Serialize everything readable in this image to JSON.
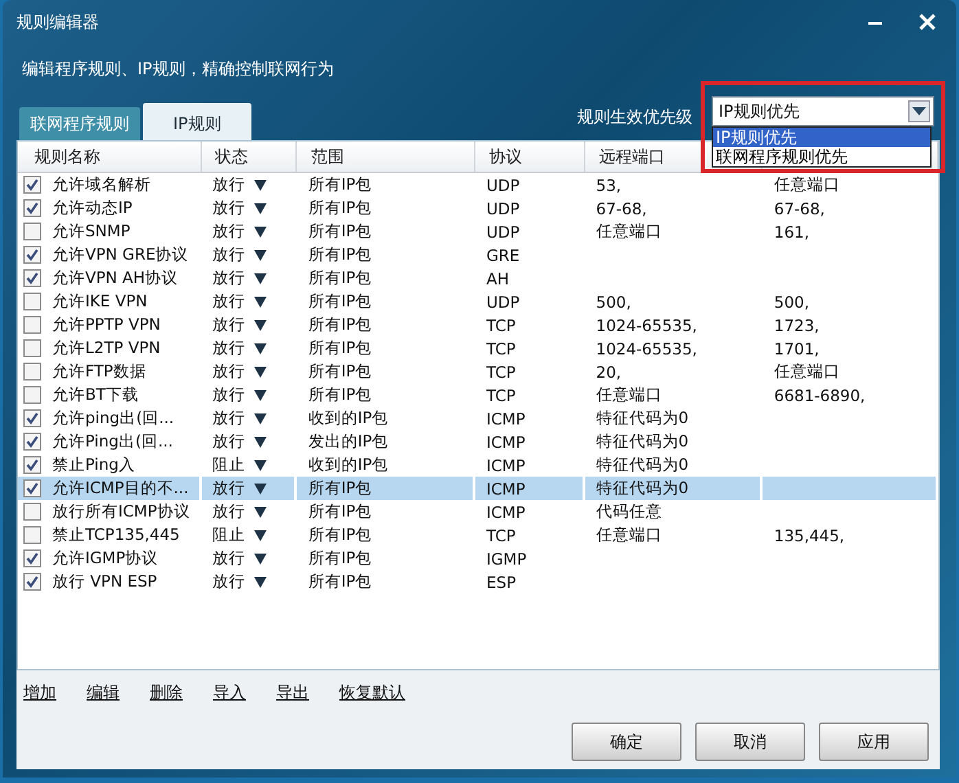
{
  "window": {
    "title": "规则编辑器",
    "description": "编辑程序规则、IP规则，精确控制联网行为"
  },
  "tabs": [
    {
      "label": "联网程序规则",
      "selected": false
    },
    {
      "label": "IP规则",
      "selected": true
    }
  ],
  "priority": {
    "label": "规则生效优先级",
    "value": "IP规则优先",
    "expanded": true,
    "options": [
      {
        "label": "IP规则优先",
        "selected": true
      },
      {
        "label": "联网程序规则优先",
        "selected": false
      }
    ]
  },
  "table": {
    "columns": [
      "规则名称",
      "状态",
      "范围",
      "协议",
      "远程端口"
    ],
    "rows": [
      {
        "checked": true,
        "selected": false,
        "name": "允许域名解析",
        "status": "放行",
        "scope": "所有IP包",
        "protocol": "UDP",
        "remote_port": "53,",
        "column_6": "任意端口"
      },
      {
        "checked": true,
        "selected": false,
        "name": "允许动态IP",
        "status": "放行",
        "scope": "所有IP包",
        "protocol": "UDP",
        "remote_port": "67-68,",
        "column_6": "67-68,"
      },
      {
        "checked": false,
        "selected": false,
        "name": "允许SNMP",
        "status": "放行",
        "scope": "所有IP包",
        "protocol": "UDP",
        "remote_port": "任意端口",
        "column_6": "161,"
      },
      {
        "checked": true,
        "selected": false,
        "name": "允许VPN GRE协议",
        "status": "放行",
        "scope": "所有IP包",
        "protocol": "GRE",
        "remote_port": "",
        "column_6": ""
      },
      {
        "checked": true,
        "selected": false,
        "name": "允许VPN AH协议",
        "status": "放行",
        "scope": "所有IP包",
        "protocol": "AH",
        "remote_port": "",
        "column_6": ""
      },
      {
        "checked": false,
        "selected": false,
        "name": "允许IKE VPN",
        "status": "放行",
        "scope": "所有IP包",
        "protocol": "UDP",
        "remote_port": "500,",
        "column_6": "500,"
      },
      {
        "checked": false,
        "selected": false,
        "name": "允许PPTP VPN",
        "status": "放行",
        "scope": "所有IP包",
        "protocol": "TCP",
        "remote_port": "1024-65535,",
        "column_6": "1723,"
      },
      {
        "checked": false,
        "selected": false,
        "name": "允许L2TP VPN",
        "status": "放行",
        "scope": "所有IP包",
        "protocol": "TCP",
        "remote_port": "1024-65535,",
        "column_6": "1701,"
      },
      {
        "checked": false,
        "selected": false,
        "name": "允许FTP数据",
        "status": "放行",
        "scope": "所有IP包",
        "protocol": "TCP",
        "remote_port": "20,",
        "column_6": "任意端口"
      },
      {
        "checked": false,
        "selected": false,
        "name": "允许BT下载",
        "status": "放行",
        "scope": "所有IP包",
        "protocol": "TCP",
        "remote_port": "任意端口",
        "column_6": "6681-6890,"
      },
      {
        "checked": true,
        "selected": false,
        "name": "允许ping出(回...",
        "status": "放行",
        "scope": "收到的IP包",
        "protocol": "ICMP",
        "remote_port": "特征代码为0",
        "column_6": ""
      },
      {
        "checked": true,
        "selected": false,
        "name": "允许Ping出(回...",
        "status": "放行",
        "scope": "发出的IP包",
        "protocol": "ICMP",
        "remote_port": "特征代码为0",
        "column_6": ""
      },
      {
        "checked": true,
        "selected": false,
        "name": "禁止Ping入",
        "status": "阻止",
        "scope": "收到的IP包",
        "protocol": "ICMP",
        "remote_port": "特征代码为0",
        "column_6": ""
      },
      {
        "checked": true,
        "selected": true,
        "name": "允许ICMP目的不...",
        "status": "放行",
        "scope": "所有IP包",
        "protocol": "ICMP",
        "remote_port": "特征代码为0",
        "column_6": ""
      },
      {
        "checked": false,
        "selected": false,
        "name": "放行所有ICMP协议",
        "status": "放行",
        "scope": "所有IP包",
        "protocol": "ICMP",
        "remote_port": "代码任意",
        "column_6": ""
      },
      {
        "checked": false,
        "selected": false,
        "name": "禁止TCP135,445",
        "status": "阻止",
        "scope": "所有IP包",
        "protocol": "TCP",
        "remote_port": "任意端口",
        "column_6": "135,445,"
      },
      {
        "checked": true,
        "selected": false,
        "name": "允许IGMP协议",
        "status": "放行",
        "scope": "所有IP包",
        "protocol": "IGMP",
        "remote_port": "",
        "column_6": ""
      },
      {
        "checked": true,
        "selected": false,
        "name": "放行 VPN ESP",
        "status": "放行",
        "scope": "所有IP包",
        "protocol": "ESP",
        "remote_port": "",
        "column_6": ""
      }
    ]
  },
  "links": [
    "增加",
    "编辑",
    "删除",
    "导入",
    "导出",
    "恢复默认"
  ],
  "buttons": [
    "确定",
    "取消",
    "应用"
  ]
}
